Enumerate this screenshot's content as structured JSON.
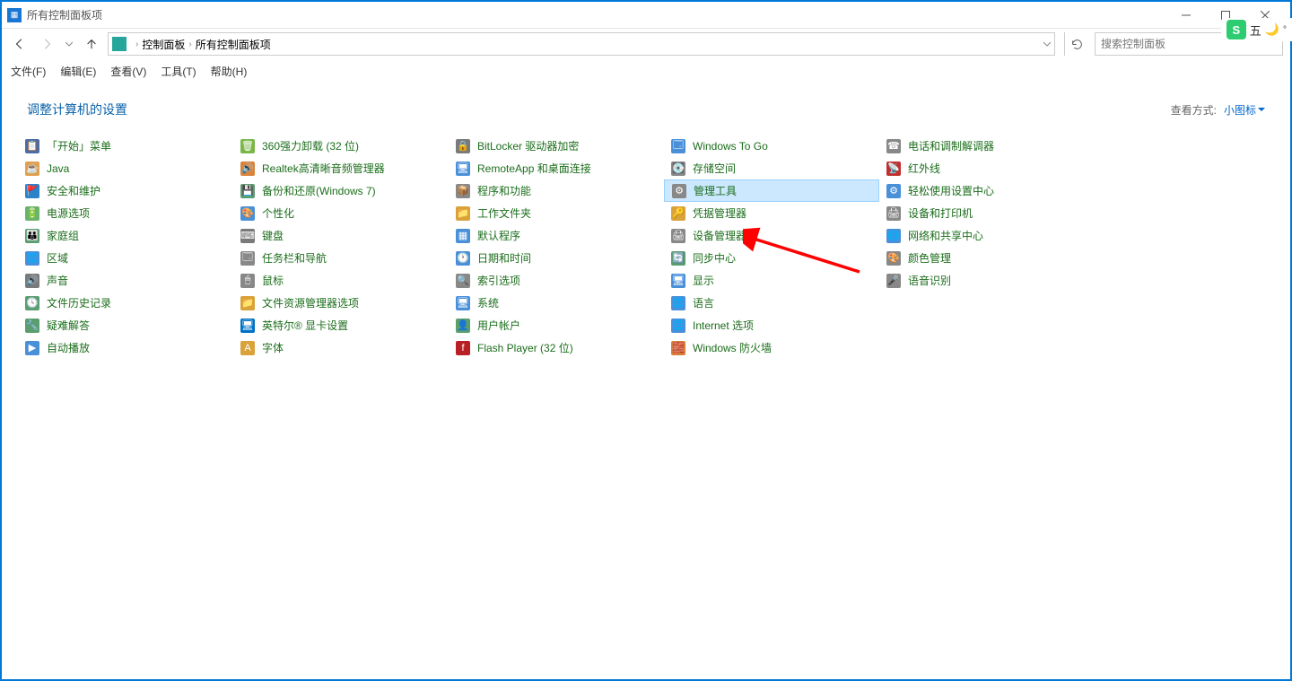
{
  "window": {
    "title": "所有控制面板项"
  },
  "breadcrumbs": {
    "parent": "控制面板",
    "current": "所有控制面板项"
  },
  "search": {
    "placeholder": "搜索控制面板"
  },
  "menu": {
    "file": "文件(F)",
    "edit": "编辑(E)",
    "view": "查看(V)",
    "tools": "工具(T)",
    "help": "帮助(H)"
  },
  "header": {
    "heading": "调整计算机的设置",
    "view_label": "查看方式:",
    "view_value": "小图标"
  },
  "items": [
    {
      "label": "「开始」菜单",
      "icon": "📋",
      "bg": "#4a6da7"
    },
    {
      "label": "Java",
      "icon": "☕",
      "bg": "#e0a050"
    },
    {
      "label": "安全和维护",
      "icon": "🚩",
      "bg": "#2c82c9"
    },
    {
      "label": "电源选项",
      "icon": "🔋",
      "bg": "#6bb36b"
    },
    {
      "label": "家庭组",
      "icon": "👪",
      "bg": "#5a9e6f"
    },
    {
      "label": "区域",
      "icon": "🌐",
      "bg": "#4a90d9"
    },
    {
      "label": "声音",
      "icon": "🔊",
      "bg": "#7a7a7a"
    },
    {
      "label": "文件历史记录",
      "icon": "🕓",
      "bg": "#5a9e6f"
    },
    {
      "label": "疑难解答",
      "icon": "🔧",
      "bg": "#5a9e6f"
    },
    {
      "label": "自动播放",
      "icon": "▶",
      "bg": "#4a90d9"
    },
    {
      "label": "360强力卸载 (32 位)",
      "icon": "🗑",
      "bg": "#7ab648"
    },
    {
      "label": "Realtek高清晰音频管理器",
      "icon": "🔊",
      "bg": "#d9843a"
    },
    {
      "label": "备份和还原(Windows 7)",
      "icon": "💾",
      "bg": "#5a9e6f"
    },
    {
      "label": "个性化",
      "icon": "🎨",
      "bg": "#4a90d9"
    },
    {
      "label": "键盘",
      "icon": "⌨",
      "bg": "#7a7a7a"
    },
    {
      "label": "任务栏和导航",
      "icon": "🗔",
      "bg": "#888"
    },
    {
      "label": "鼠标",
      "icon": "🖱",
      "bg": "#888"
    },
    {
      "label": "文件资源管理器选项",
      "icon": "📁",
      "bg": "#d9a23a"
    },
    {
      "label": "英特尔® 显卡设置",
      "icon": "🖥",
      "bg": "#0071c5"
    },
    {
      "label": "字体",
      "icon": "A",
      "bg": "#d9a23a"
    },
    {
      "label": "BitLocker 驱动器加密",
      "icon": "🔒",
      "bg": "#7a7a7a"
    },
    {
      "label": "RemoteApp 和桌面连接",
      "icon": "🖥",
      "bg": "#4a90d9"
    },
    {
      "label": "程序和功能",
      "icon": "📦",
      "bg": "#888"
    },
    {
      "label": "工作文件夹",
      "icon": "📁",
      "bg": "#d9a23a"
    },
    {
      "label": "默认程序",
      "icon": "▦",
      "bg": "#4a90d9"
    },
    {
      "label": "日期和时间",
      "icon": "🕐",
      "bg": "#4a90d9"
    },
    {
      "label": "索引选项",
      "icon": "🔍",
      "bg": "#888"
    },
    {
      "label": "系统",
      "icon": "🖥",
      "bg": "#4a90d9"
    },
    {
      "label": "用户帐户",
      "icon": "👤",
      "bg": "#5a9e6f"
    },
    {
      "label": "Flash Player (32 位)",
      "icon": "f",
      "bg": "#b82025"
    },
    {
      "label": "Windows To Go",
      "icon": "🗔",
      "bg": "#4a90d9"
    },
    {
      "label": "存储空间",
      "icon": "💽",
      "bg": "#888"
    },
    {
      "label": "管理工具",
      "icon": "⚙",
      "bg": "#888",
      "highlighted": true
    },
    {
      "label": "凭据管理器",
      "icon": "🔑",
      "bg": "#d9a23a"
    },
    {
      "label": "设备管理器",
      "icon": "🖨",
      "bg": "#888"
    },
    {
      "label": "同步中心",
      "icon": "🔄",
      "bg": "#5a9e6f"
    },
    {
      "label": "显示",
      "icon": "🖥",
      "bg": "#4a90d9"
    },
    {
      "label": "语言",
      "icon": "🌐",
      "bg": "#4a90d9"
    },
    {
      "label": "Internet 选项",
      "icon": "🌐",
      "bg": "#4a90d9"
    },
    {
      "label": "Windows 防火墙",
      "icon": "🧱",
      "bg": "#d97f3a"
    },
    {
      "label": "电话和调制解调器",
      "icon": "☎",
      "bg": "#888"
    },
    {
      "label": "红外线",
      "icon": "📡",
      "bg": "#c03030"
    },
    {
      "label": "轻松使用设置中心",
      "icon": "⚙",
      "bg": "#4a90d9"
    },
    {
      "label": "设备和打印机",
      "icon": "🖨",
      "bg": "#888"
    },
    {
      "label": "网络和共享中心",
      "icon": "🌐",
      "bg": "#4a90d9"
    },
    {
      "label": "颜色管理",
      "icon": "🎨",
      "bg": "#888"
    },
    {
      "label": "语音识别",
      "icon": "🎤",
      "bg": "#888"
    }
  ],
  "ime": {
    "logo": "S",
    "label": "五"
  }
}
